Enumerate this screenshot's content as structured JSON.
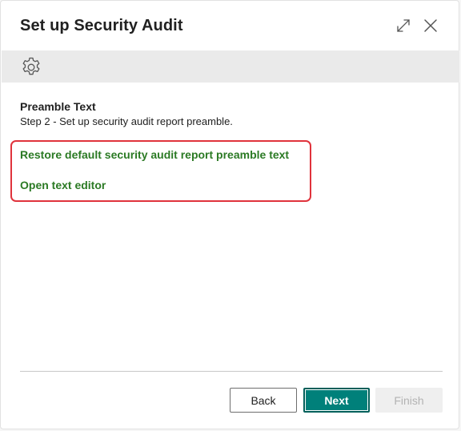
{
  "dialog": {
    "title": "Set up Security Audit"
  },
  "icons": {
    "expand": "expand-icon",
    "close": "close-icon",
    "settings": "gear-icon"
  },
  "step": {
    "heading": "Preamble Text",
    "description": "Step 2 - Set up security audit report preamble."
  },
  "actions": {
    "restore_label": "Restore default security audit report preamble text",
    "editor_label": "Open text editor"
  },
  "footer": {
    "back_label": "Back",
    "next_label": "Next",
    "finish_label": "Finish"
  },
  "colors": {
    "accent": "#00807a",
    "link": "#2b7a24",
    "highlight": "#e0333c"
  }
}
